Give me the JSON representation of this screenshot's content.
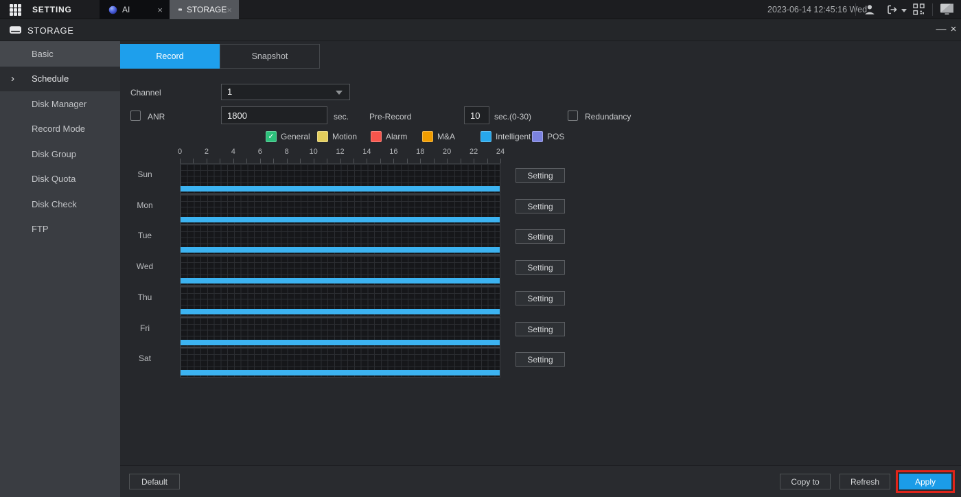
{
  "icons": {
    "check": "✓",
    "sidebar_arrow": "›"
  },
  "topbar": {
    "setting_label": "SETTING",
    "tabs": [
      {
        "label": "AI",
        "icon": "ai-icon",
        "close": "×"
      },
      {
        "label": "STORAGE",
        "icon": "storage-icon",
        "close": "×",
        "active": true
      }
    ],
    "datetime": "2023-06-14 12:45:16 Wed",
    "right_icons": [
      "user-icon",
      "logout-icon",
      "qr-code-icon",
      "display-icon"
    ]
  },
  "window": {
    "title": "STORAGE",
    "minimize": "—",
    "close": "×"
  },
  "sidebar": {
    "items": [
      {
        "label": "Basic"
      },
      {
        "label": "Schedule",
        "selected": true
      },
      {
        "label": "Disk Manager"
      },
      {
        "label": "Record Mode"
      },
      {
        "label": "Disk Group"
      },
      {
        "label": "Disk Quota"
      },
      {
        "label": "Disk Check"
      },
      {
        "label": "FTP"
      }
    ]
  },
  "content": {
    "tabs": [
      {
        "label": "Record",
        "active": true
      },
      {
        "label": "Snapshot",
        "active": false
      }
    ],
    "channel": {
      "label": "Channel",
      "value": "1"
    },
    "anr": {
      "label": "ANR",
      "checked": false,
      "value": "1800",
      "unit": "sec."
    },
    "pre_record": {
      "label": "Pre-Record",
      "value": "10",
      "unit": "sec.(0-30)"
    },
    "redundancy": {
      "label": "Redundancy",
      "checked": false
    },
    "legend": [
      {
        "label": "General",
        "color": "#2cc17b",
        "checked": true
      },
      {
        "label": "Motion",
        "color": "#e3ce5c",
        "checked": false
      },
      {
        "label": "Alarm",
        "color": "#f8554c",
        "checked": false
      },
      {
        "label": "M&A",
        "color": "#f09c00",
        "checked": false
      },
      {
        "label": "Intelligent",
        "color": "#27a8ec",
        "checked": false
      },
      {
        "label": "POS",
        "color": "#7b82df",
        "checked": false
      }
    ],
    "schedule": {
      "hours": [
        "0",
        "2",
        "4",
        "6",
        "8",
        "10",
        "12",
        "14",
        "16",
        "18",
        "20",
        "22",
        "24"
      ],
      "bar_color": "#3cb3f1",
      "setting_button": "Setting",
      "days": [
        {
          "label": "Sun",
          "bars": [
            {
              "start": 0,
              "end": 24,
              "type": "Intelligent"
            }
          ]
        },
        {
          "label": "Mon",
          "bars": [
            {
              "start": 0,
              "end": 24,
              "type": "Intelligent"
            }
          ]
        },
        {
          "label": "Tue",
          "bars": [
            {
              "start": 0,
              "end": 24,
              "type": "Intelligent"
            }
          ]
        },
        {
          "label": "Wed",
          "bars": [
            {
              "start": 0,
              "end": 24,
              "type": "Intelligent"
            }
          ]
        },
        {
          "label": "Thu",
          "bars": [
            {
              "start": 0,
              "end": 24,
              "type": "Intelligent"
            }
          ]
        },
        {
          "label": "Fri",
          "bars": [
            {
              "start": 0,
              "end": 24,
              "type": "Intelligent"
            }
          ]
        },
        {
          "label": "Sat",
          "bars": [
            {
              "start": 0,
              "end": 24,
              "type": "Intelligent"
            }
          ]
        }
      ]
    },
    "footer": {
      "default": "Default",
      "copy_to": "Copy to",
      "refresh": "Refresh",
      "apply": "Apply"
    },
    "annotation": {
      "target": "apply-button",
      "color": "#e0241a"
    }
  }
}
